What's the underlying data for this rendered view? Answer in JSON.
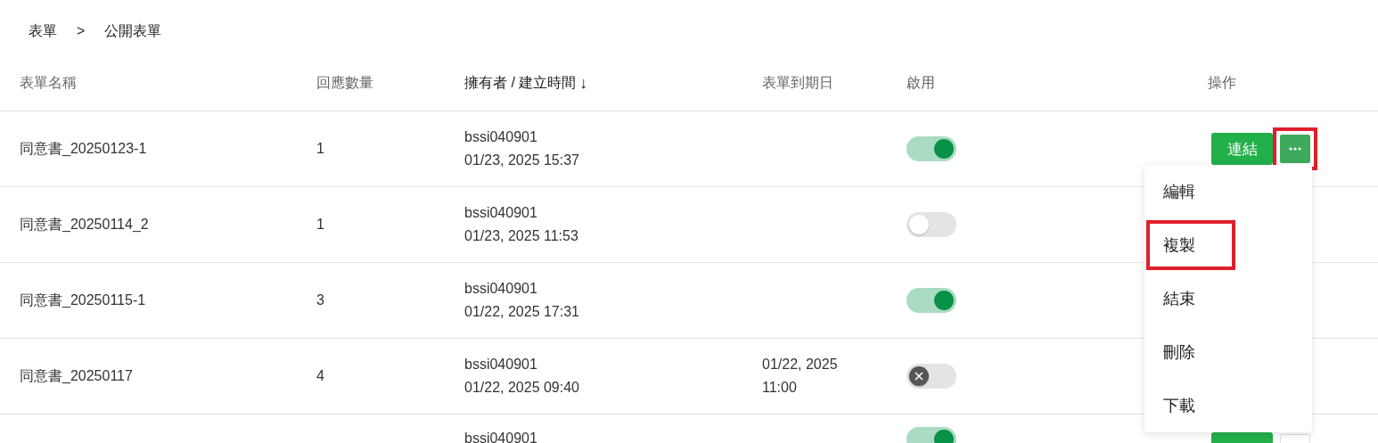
{
  "breadcrumb": {
    "items": [
      "表單",
      "公開表單"
    ],
    "separator": ">"
  },
  "table": {
    "columns": [
      {
        "label": "表單名稱",
        "sorted": false
      },
      {
        "label": "回應數量",
        "sorted": false
      },
      {
        "label": "擁有者 / 建立時間",
        "sorted": true,
        "sort_icon": "↓"
      },
      {
        "label": "表單到期日",
        "sorted": false
      },
      {
        "label": "啟用",
        "sorted": false
      },
      {
        "label": "操作",
        "sorted": false
      }
    ],
    "rows": [
      {
        "name": "同意書_20250123-1",
        "responses": "1",
        "owner": "bssi040901",
        "created": "01/23, 2025 15:37",
        "due": "",
        "enabled": true,
        "toggle_disabled": false,
        "link_label": "連結",
        "more_highlighted": true
      },
      {
        "name": "同意書_20250114_2",
        "responses": "1",
        "owner": "bssi040901",
        "created": "01/23, 2025 11:53",
        "due": "",
        "enabled": false,
        "toggle_disabled": false
      },
      {
        "name": "同意書_20250115-1",
        "responses": "3",
        "owner": "bssi040901",
        "created": "01/22, 2025 17:31",
        "due": "",
        "enabled": true,
        "toggle_disabled": false
      },
      {
        "name": "同意書_20250117",
        "responses": "4",
        "owner": "bssi040901",
        "created": "01/22, 2025 09:40",
        "due": "01/22, 2025 11:00",
        "enabled": false,
        "toggle_disabled": true
      },
      {
        "name": "",
        "responses": "",
        "owner": "bssi040901",
        "created": "",
        "due": "",
        "enabled": true,
        "toggle_disabled": false,
        "link_label": "",
        "more_highlighted": false
      }
    ]
  },
  "menu": {
    "items": [
      {
        "label": "編輯",
        "highlighted": false
      },
      {
        "label": "複製",
        "highlighted": true
      },
      {
        "label": "結束",
        "highlighted": false
      },
      {
        "label": "刪除",
        "highlighted": false
      },
      {
        "label": "下載",
        "highlighted": false
      }
    ]
  }
}
